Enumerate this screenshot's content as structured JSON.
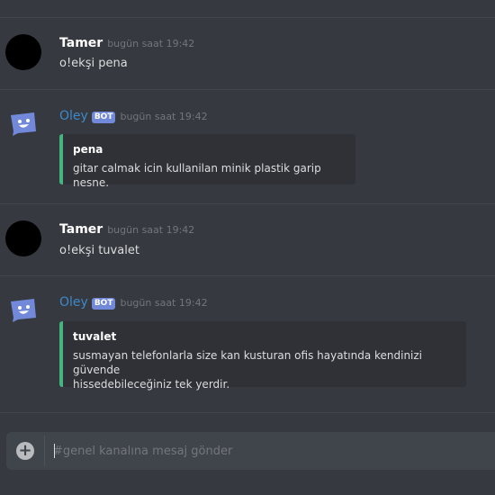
{
  "messages": [
    {
      "author": "Tamer",
      "timestamp": "bugün saat 19:42",
      "text": "o!ekşi pena"
    },
    {
      "author": "Oley",
      "bot_tag": "BOT",
      "timestamp": "bugün saat 19:42",
      "embed": {
        "title": "pena",
        "description": "gitar calmak icin kullanilan minik plastik garip nesne."
      }
    },
    {
      "author": "Tamer",
      "timestamp": "bugün saat 19:42",
      "text": "o!ekşi tuvalet"
    },
    {
      "author": "Oley",
      "bot_tag": "BOT",
      "timestamp": "bugün saat 19:42",
      "embed": {
        "title": "tuvalet",
        "description_line1": "susmayan telefonlarla size kan kusturan ofis hayatında kendinizi güvende",
        "description_line2": "hissedebileceğiniz tek yerdir."
      }
    }
  ],
  "composer": {
    "attach_icon": "plus-circle-icon",
    "placeholder": "#genel kanalına mesaj gönder"
  },
  "colors": {
    "background": "#36393f",
    "embed_bar": "#43b581",
    "bot_name": "#3e89c9",
    "bot_tag": "#7289da",
    "bot_avatar": "#7289da"
  }
}
